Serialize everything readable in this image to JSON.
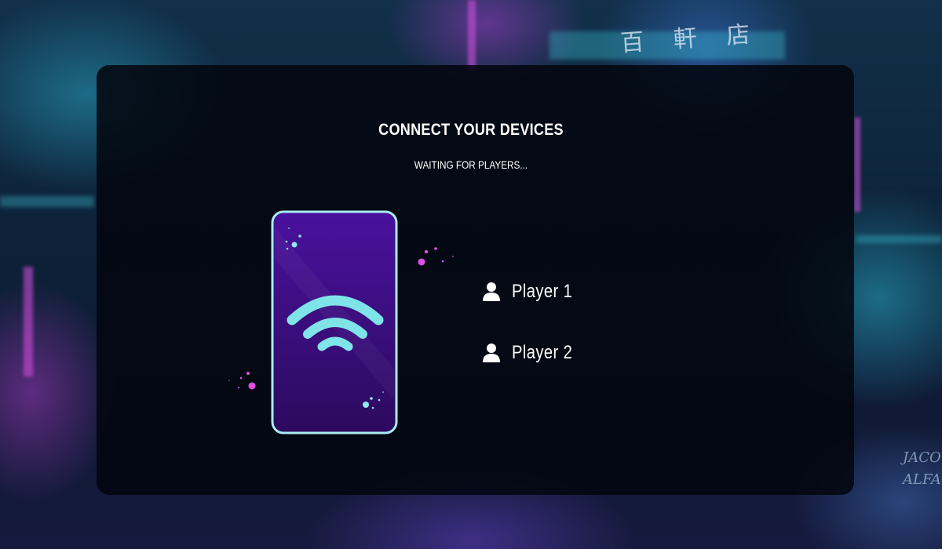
{
  "background": {
    "sign_text": "百 軒 店",
    "signature_lines": [
      "JACO",
      "ALFA"
    ]
  },
  "dialog": {
    "title": "CONNECT YOUR DEVICES",
    "subtitle": "WAITING FOR PLAYERS..."
  },
  "illustration": {
    "icon": "phone-wifi-icon",
    "colors": {
      "phone_border": "#a8ecf2",
      "phone_fill_top": "#4a119e",
      "phone_fill_bottom": "#2c0a5e",
      "wifi": "#7fe4e8",
      "sparkle_pink": "#e04ee0",
      "sparkle_cyan": "#8fe8ee"
    }
  },
  "players": [
    {
      "label": "Player  1",
      "icon": "user-icon"
    },
    {
      "label": "Player  2",
      "icon": "user-icon"
    }
  ]
}
